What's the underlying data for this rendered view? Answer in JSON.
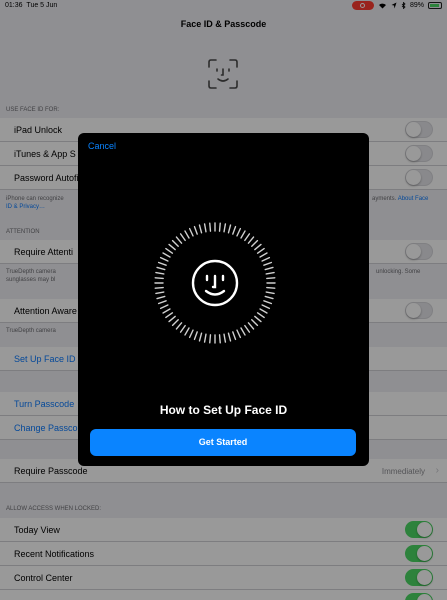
{
  "status_bar": {
    "time": "01:36",
    "date": "Tue 5 Jun",
    "battery": "89%",
    "battery_level": 0.89
  },
  "navbar": {
    "title": "Face ID & Passcode"
  },
  "sections": {
    "use_face_id_header": "USE FACE ID FOR:",
    "attention_header": "ATTENTION",
    "allow_access_header": "ALLOW ACCESS WHEN LOCKED:"
  },
  "rows": {
    "ipad_unlock": "iPad Unlock",
    "itunes_app_store": "iTunes & App S",
    "password_autofill": "Password Autofi",
    "require_attention": "Require Attenti",
    "attention_aware": "Attention Aware",
    "set_up_face_id": "Set Up Face ID",
    "turn_passcode_off": "Turn Passcode",
    "change_passcode": "Change Passco",
    "require_passcode": "Require Passcode",
    "require_passcode_value": "Immediately",
    "today_view": "Today View",
    "recent_notifications": "Recent Notifications",
    "control_center": "Control Center"
  },
  "footers": {
    "face_id_left": "iPhone can recognize",
    "face_id_left2": "ID & Privacy…",
    "face_id_right": "ayments.",
    "face_id_link": "About Face",
    "attention_left": "TrueDepth camera",
    "attention_left2": "sunglasses may bl",
    "attention_right": "unlocking. Some",
    "aware_left": "TrueDepth camera"
  },
  "toggles": {
    "ipad_unlock": false,
    "itunes_app_store": false,
    "password_autofill": false,
    "require_attention": false,
    "attention_aware": false,
    "today_view": true,
    "recent_notifications": true,
    "control_center": true
  },
  "modal": {
    "cancel_label": "Cancel",
    "heading": "How to Set Up Face ID",
    "button_label": "Get Started"
  },
  "colors": {
    "accent_blue": "#0a84ff",
    "toggle_on": "#4cd964",
    "record_red": "#ff3b30"
  }
}
